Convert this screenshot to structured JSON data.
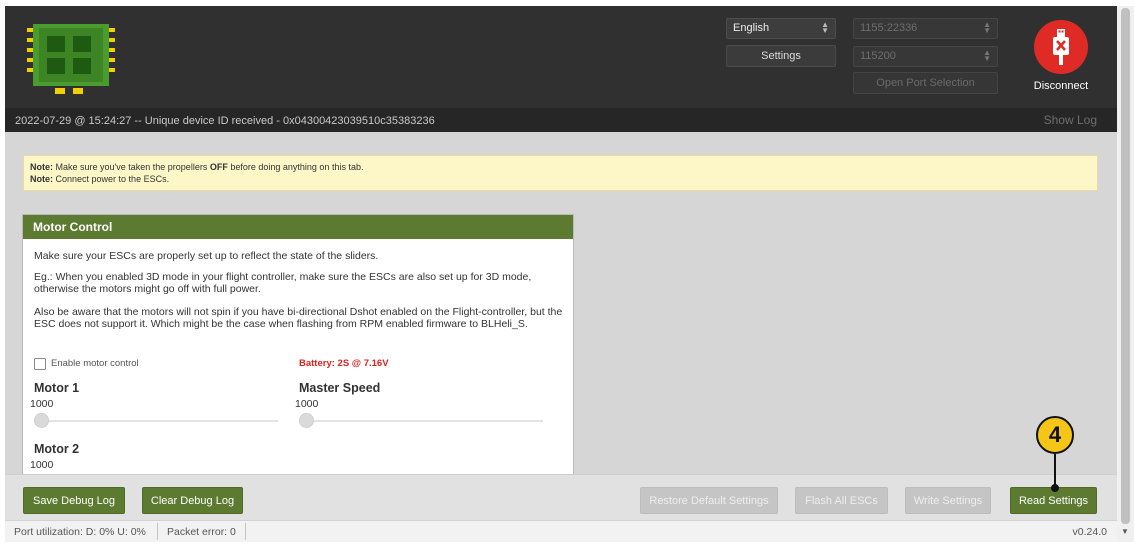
{
  "header": {
    "language": "English",
    "settings_label": "Settings",
    "port": "1155:22336",
    "baud": "115200",
    "open_port_label": "Open Port Selection",
    "disconnect_label": "Disconnect"
  },
  "logbar": {
    "message": "2022-07-29 @ 15:24:27 -- Unique device ID received - 0x04300423039510c35383236",
    "show_log_label": "Show Log"
  },
  "notes": {
    "line1_label": "Note:",
    "line1_pre": "Make sure you've taken the propellers",
    "line1_bold": "OFF",
    "line1_post": "before doing anything on this tab.",
    "line2_label": "Note:",
    "line2_text": "Connect power to the ESCs."
  },
  "motor_control": {
    "title": "Motor Control",
    "para1": "Make sure your ESCs are properly set up to reflect the state of the sliders.",
    "para2": "Eg.: When you enabled 3D mode in your flight controller, make sure the ESCs are also set up for 3D mode, otherwise the motors might go off with full power.",
    "para3": "Also be aware that the motors will not spin if you have bi-directional Dshot enabled on the Flight-controller, but the ESC does not support it. Which might be the case when flashing from RPM enabled firmware to BLHeli_S.",
    "enable_label": "Enable motor control",
    "battery": "Battery: 2S @ 7.16V",
    "motor1_label": "Motor 1",
    "motor1_value": "1000",
    "master_label": "Master Speed",
    "master_value": "1000",
    "motor2_label": "Motor 2",
    "motor2_value": "1000"
  },
  "toolbar": {
    "save_debug": "Save Debug Log",
    "clear_debug": "Clear Debug Log",
    "restore_default": "Restore Default Settings",
    "flash_all": "Flash All ESCs",
    "write_settings": "Write Settings",
    "read_settings": "Read Settings"
  },
  "callout": {
    "number": "4"
  },
  "statusbar": {
    "port_util": "Port utilization: D: 0% U: 0%",
    "packet_error": "Packet error: 0",
    "version": "v0.24.0"
  },
  "colors": {
    "accent_green": "#5c7a30",
    "disconnect_red": "#e02a26",
    "battery_red": "#e0201c",
    "callout_yellow": "#f5c518"
  }
}
